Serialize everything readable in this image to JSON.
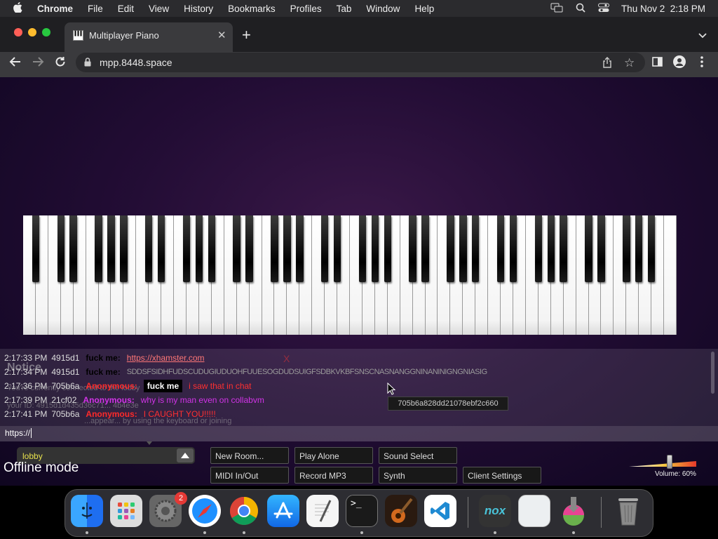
{
  "menubar": {
    "app": "Chrome",
    "items": [
      "File",
      "Edit",
      "View",
      "History",
      "Bookmarks",
      "Profiles",
      "Tab",
      "Window",
      "Help"
    ],
    "datetime": "Thu Nov 2  2:18 PM"
  },
  "browser": {
    "tab_title": "Multiplayer Piano",
    "url": "mpp.8448.space"
  },
  "chat": {
    "messages": [
      {
        "time": "2:17:33 PM",
        "id": "4915d1",
        "name": "fuck me:",
        "text": "https://xhamster.com",
        "name_color": "#000000",
        "text_color": "#ff7777"
      },
      {
        "time": "2:17:34 PM",
        "id": "4915d1",
        "name": "fuck me:",
        "text": "SDDSFSIDHFUDSCUDUGIUDUOHFUUESOGDUDSUIGFSDBKVKBFSNSCNASNANGGNINANINIGNGNIASIG",
        "name_color": "#000000",
        "text_color": "#9a9a9a"
      },
      {
        "time": "2:17:36 PM",
        "id": "705b6a",
        "name": "Anonymous:",
        "tag": "fuck me",
        "text": "i saw that in chat",
        "name_color": "#ff2a2a",
        "text_color": "#ff3030"
      },
      {
        "time": "2:17:39 PM",
        "id": "21cf02",
        "name": "Anonymous:",
        "text": "why is my man even on collabvm",
        "name_color": "#d233e8",
        "text_color": "#d233e8"
      },
      {
        "time": "2:17:41 PM",
        "id": "705b6a",
        "name": "Anonymous:",
        "text": "I CAUGHT YOU!!!!!",
        "name_color": "#ff2a2a",
        "text_color": "#ff3030"
      }
    ],
    "notice_title": "Notice",
    "notice_close": "X",
    "notice_lines": [
      "You're currently connected to the lobby",
      "your ID: 4915d1d435d36c71... 4b4e3e",
      "...appear... by using the keyboard or joining"
    ],
    "input_value": "https://",
    "tooltip": "705b6a828dd21078ebf2c660"
  },
  "controls": {
    "room": "lobby",
    "offline": "Offline mode",
    "new_room": "New Room...",
    "play_alone": "Play Alone",
    "sound_select": "Sound Select",
    "midi": "MIDI In/Out",
    "record": "Record MP3",
    "synth": "Synth",
    "client_settings": "Client Settings",
    "volume": "Volume: 60%",
    "volume_level": 0.6
  },
  "dock": {
    "apps": [
      "Finder",
      "Launchpad",
      "System Settings",
      "Safari",
      "Chrome",
      "App Store",
      "TextEdit",
      "Terminal",
      "GarageBand",
      "VS Code",
      "Nox",
      "Preview",
      "Installer",
      "Trash"
    ],
    "settings_badge": "2"
  }
}
